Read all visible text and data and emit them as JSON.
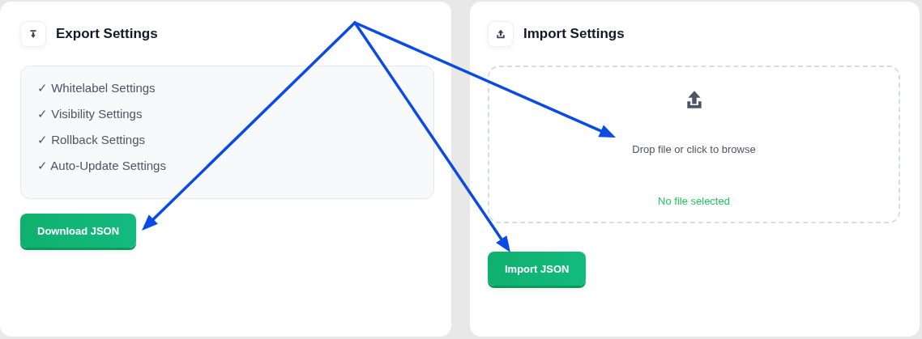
{
  "export_panel": {
    "title": "Export Settings",
    "items": [
      "✓ Whitelabel Settings",
      "✓ Visibility Settings",
      "✓ Rollback Settings",
      "✓ Auto-Update Settings"
    ],
    "button": "Download JSON"
  },
  "import_panel": {
    "title": "Import Settings",
    "dropzone": {
      "prompt": "Drop file or click to browse",
      "status": "No file selected"
    },
    "button": "Import JSON"
  }
}
